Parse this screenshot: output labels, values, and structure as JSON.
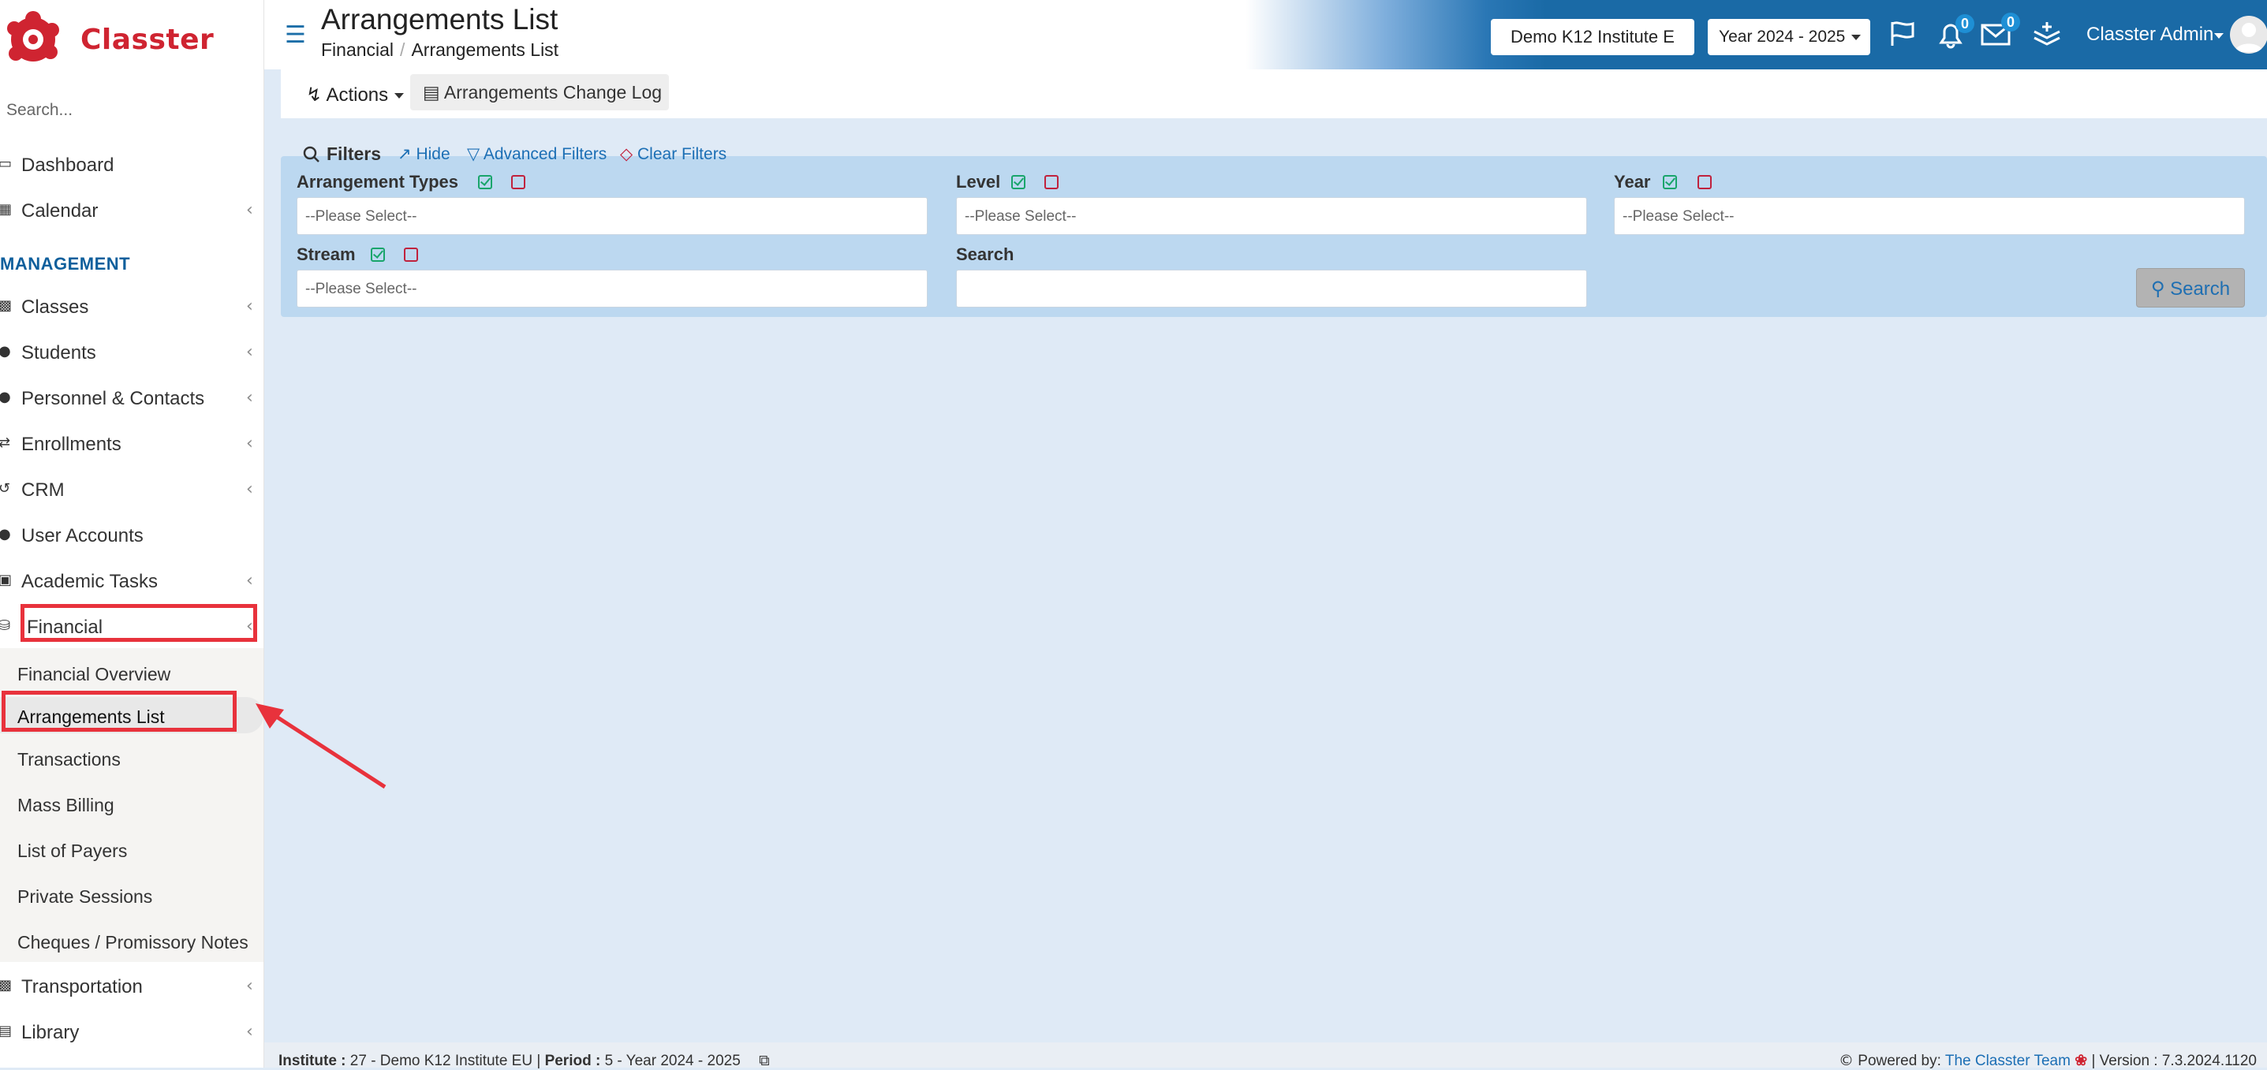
{
  "app": {
    "logo_text": "Classter"
  },
  "sidebar": {
    "search_placeholder": "Search...",
    "items_top": [
      {
        "label": "Dashboard",
        "icon": "laptop-icon"
      },
      {
        "label": "Calendar",
        "icon": "calendar-icon"
      }
    ],
    "section_label": "MANAGEMENT",
    "items": [
      {
        "label": "Classes",
        "icon": "classes-icon"
      },
      {
        "label": "Students",
        "icon": "students-icon"
      },
      {
        "label": "Personnel & Contacts",
        "icon": "personnel-icon"
      },
      {
        "label": "Enrollments",
        "icon": "enrollments-icon"
      },
      {
        "label": "CRM",
        "icon": "crm-icon"
      },
      {
        "label": "User Accounts",
        "icon": "user-accounts-icon"
      },
      {
        "label": "Academic Tasks",
        "icon": "academic-tasks-icon"
      },
      {
        "label": "Financial",
        "icon": "coins-icon"
      }
    ],
    "financial_submenu": [
      "Financial Overview",
      "Arrangements List",
      "Transactions",
      "Mass Billing",
      "List of Payers",
      "Private Sessions",
      "Cheques / Promissory Notes"
    ],
    "items_bottom": [
      {
        "label": "Transportation",
        "icon": "bus-icon"
      },
      {
        "label": "Library",
        "icon": "library-icon"
      }
    ]
  },
  "header": {
    "title": "Arrangements List",
    "breadcrumb": [
      "Financial",
      "Arrangements List"
    ],
    "institute": "Demo K12 Institute E",
    "year": "Year 2024 - 2025",
    "notifications_count": "0",
    "messages_count": "0",
    "user_name": "Classter Admin"
  },
  "toolbar": {
    "actions_label": "Actions",
    "change_log_label": "Arrangements Change Log"
  },
  "filters": {
    "title": "Filters",
    "hide_label": "Hide",
    "advanced_label": "Advanced Filters",
    "clear_label": "Clear Filters",
    "fields": {
      "arrangement_types": {
        "label": "Arrangement Types",
        "placeholder": "--Please Select--"
      },
      "level": {
        "label": "Level",
        "placeholder": "--Please Select--"
      },
      "year": {
        "label": "Year",
        "placeholder": "--Please Select--"
      },
      "stream": {
        "label": "Stream",
        "placeholder": "--Please Select--"
      },
      "search": {
        "label": "Search",
        "value": ""
      }
    },
    "search_button": "Search"
  },
  "footer": {
    "institute_label": "Institute :",
    "institute_value": "27 - Demo K12 Institute EU",
    "period_label": "Period :",
    "period_value": "5 - Year 2024 - 2025",
    "powered_by": "Powered by:",
    "powered_link": "The Classter Team",
    "version": "| Version : 7.3.2024.1120"
  },
  "colors": {
    "brand_red": "#cf2431",
    "header_blue": "#1a6aa6",
    "filter_panel": "#bcd8f0",
    "annotation_red": "#e8323c"
  }
}
